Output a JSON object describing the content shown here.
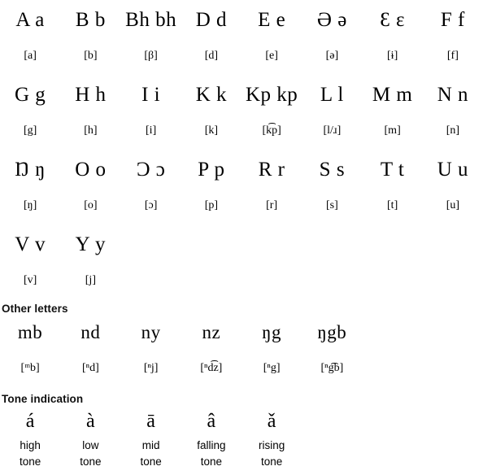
{
  "alphabet": {
    "rows": [
      [
        {
          "letter": "A a",
          "ipa": "[a]"
        },
        {
          "letter": "B b",
          "ipa": "[b]"
        },
        {
          "letter": "Bh bh",
          "ipa": "[β]"
        },
        {
          "letter": "D d",
          "ipa": "[d]"
        },
        {
          "letter": "E e",
          "ipa": "[e]"
        },
        {
          "letter": "Ə ə",
          "ipa": "[ə]"
        },
        {
          "letter": "Ɛ ɛ",
          "ipa": "[ɨ]"
        },
        {
          "letter": "F f",
          "ipa": "[f]"
        }
      ],
      [
        {
          "letter": "G g",
          "ipa": "[g]"
        },
        {
          "letter": "H h",
          "ipa": "[h]"
        },
        {
          "letter": "I i",
          "ipa": "[i]"
        },
        {
          "letter": "K k",
          "ipa": "[k]"
        },
        {
          "letter": "Kp kp",
          "ipa": "[k͡p]"
        },
        {
          "letter": "L l",
          "ipa": "[l/ɹ]"
        },
        {
          "letter": "M m",
          "ipa": "[m]"
        },
        {
          "letter": "N n",
          "ipa": "[n]"
        }
      ],
      [
        {
          "letter": "Ŋ ŋ",
          "ipa": "[ŋ]"
        },
        {
          "letter": "O o",
          "ipa": "[o]"
        },
        {
          "letter": "Ɔ ɔ",
          "ipa": "[ɔ]"
        },
        {
          "letter": "P p",
          "ipa": "[p]"
        },
        {
          "letter": "R r",
          "ipa": "[r]"
        },
        {
          "letter": "S s",
          "ipa": "[s]"
        },
        {
          "letter": "T t",
          "ipa": "[t]"
        },
        {
          "letter": "U u",
          "ipa": "[u]"
        }
      ],
      [
        {
          "letter": "V v",
          "ipa": "[v]"
        },
        {
          "letter": "Y y",
          "ipa": "[j]"
        },
        {
          "letter": "",
          "ipa": ""
        },
        {
          "letter": "",
          "ipa": ""
        },
        {
          "letter": "",
          "ipa": ""
        },
        {
          "letter": "",
          "ipa": ""
        },
        {
          "letter": "",
          "ipa": ""
        },
        {
          "letter": "",
          "ipa": ""
        }
      ]
    ]
  },
  "other_letters": {
    "heading": "Other letters",
    "items": [
      {
        "letter": "mb",
        "ipa": "[ᵐb]"
      },
      {
        "letter": "nd",
        "ipa": "[ⁿd]"
      },
      {
        "letter": "ny",
        "ipa": "[ⁿj]"
      },
      {
        "letter": "nz",
        "ipa": "[ⁿd͡z]"
      },
      {
        "letter": "ŋg",
        "ipa": "[ⁿg]"
      },
      {
        "letter": "ŋgb",
        "ipa": "[ⁿg͡b]"
      },
      {
        "letter": "",
        "ipa": ""
      },
      {
        "letter": "",
        "ipa": ""
      }
    ]
  },
  "tone_indication": {
    "heading": "Tone indication",
    "items": [
      {
        "mark": "á",
        "label_line1": "high",
        "label_line2": "tone"
      },
      {
        "mark": "à",
        "label_line1": "low",
        "label_line2": "tone"
      },
      {
        "mark": "ā",
        "label_line1": "mid",
        "label_line2": "tone"
      },
      {
        "mark": "â",
        "label_line1": "falling",
        "label_line2": "tone"
      },
      {
        "mark": "ǎ",
        "label_line1": "rising",
        "label_line2": "tone"
      },
      {
        "mark": "",
        "label_line1": "",
        "label_line2": ""
      },
      {
        "mark": "",
        "label_line1": "",
        "label_line2": ""
      },
      {
        "mark": "",
        "label_line1": "",
        "label_line2": ""
      }
    ]
  },
  "colors": {
    "background": "#ffffff",
    "text": "#000000",
    "heading": "#111111"
  }
}
